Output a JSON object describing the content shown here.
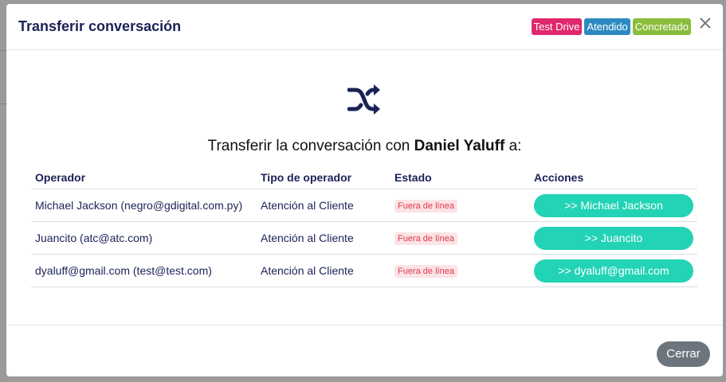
{
  "modal": {
    "title": "Transferir conversación",
    "badges": [
      {
        "label": "Test Drive",
        "color": "#e0286e"
      },
      {
        "label": "Atendido",
        "color": "#2d8ac0"
      },
      {
        "label": "Concretado",
        "color": "#8bbd3d"
      }
    ],
    "close_icon": "close-icon",
    "transfer_prefix": "Transferir la conversación con",
    "contact_name": "Daniel Yaluff",
    "transfer_suffix": "a:",
    "table": {
      "headers": {
        "operator": "Operador",
        "type": "Tipo de operador",
        "status": "Estado",
        "actions": "Acciones"
      },
      "rows": [
        {
          "operator": "Michael Jackson (negro@gdigital.com.py)",
          "type": "Atención al Cliente",
          "status": "Fuera de línea",
          "action": ">> Michael Jackson"
        },
        {
          "operator": "Juancito (atc@atc.com)",
          "type": "Atención al Cliente",
          "status": "Fuera de línea",
          "action": ">> Juancito"
        },
        {
          "operator": "dyaluff@gmail.com (test@test.com)",
          "type": "Atención al Cliente",
          "status": "Fuera de línea",
          "action": ">> dyaluff@gmail.com"
        }
      ]
    },
    "footer": {
      "close_label": "Cerrar"
    }
  },
  "colors": {
    "accent": "#22d3b5",
    "title": "#1b2256",
    "status_bg": "#fbe3e6",
    "status_text": "#e03a48"
  }
}
